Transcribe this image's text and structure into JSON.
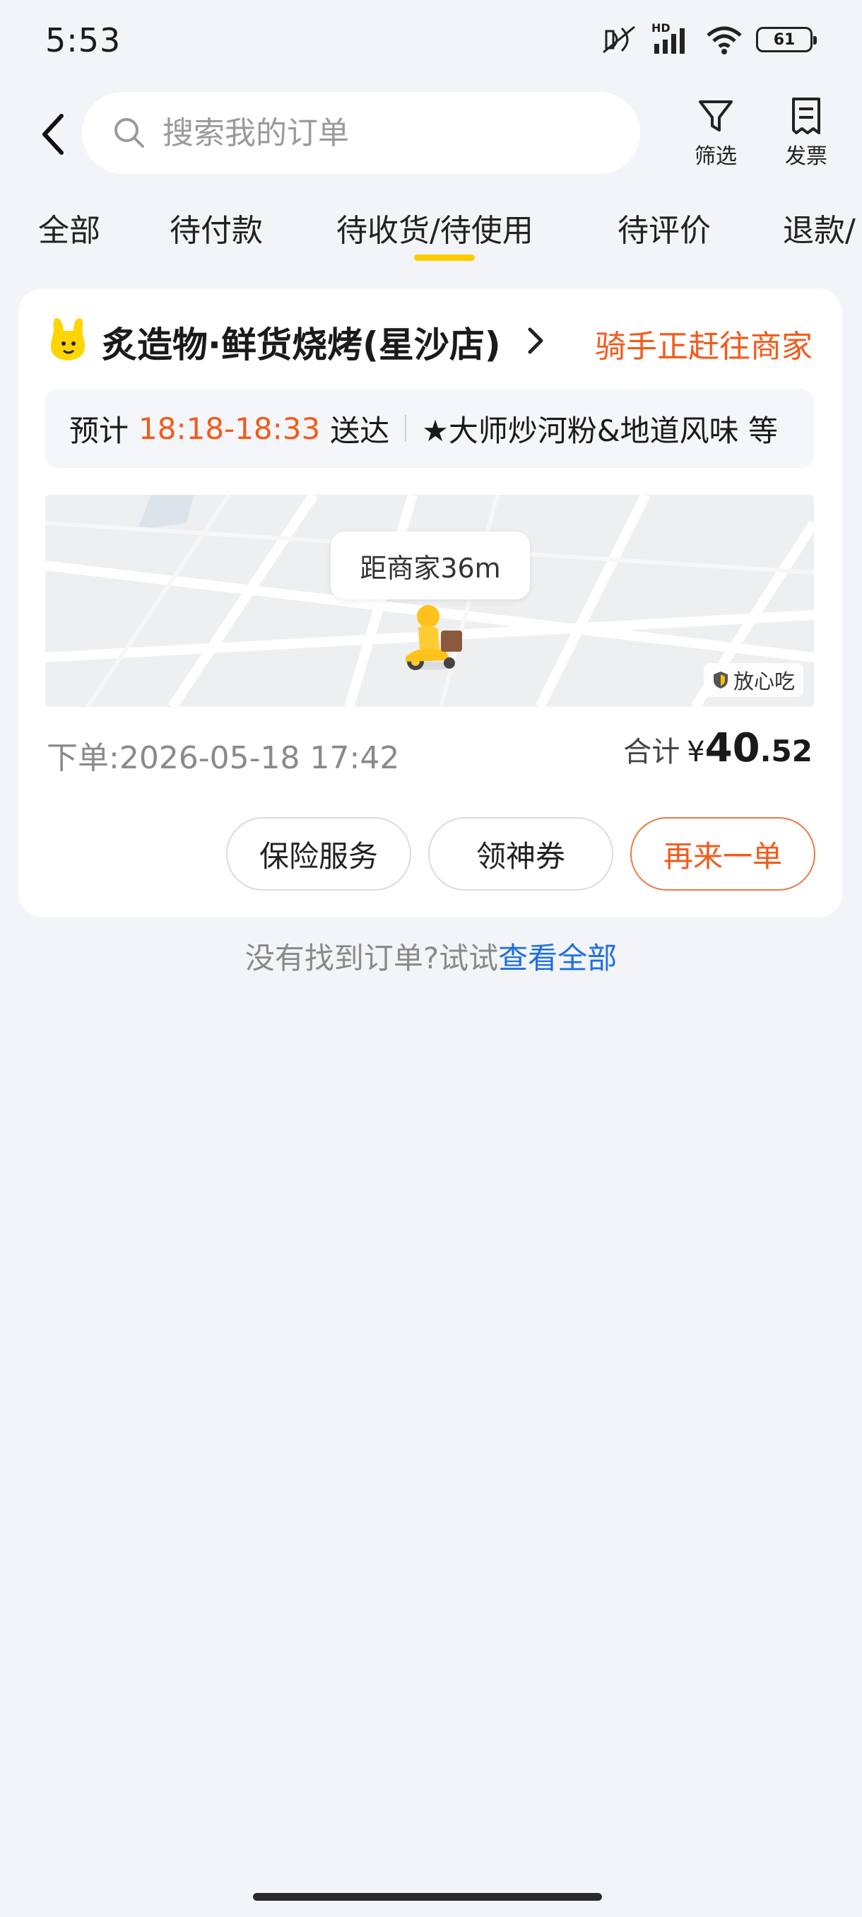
{
  "status_bar": {
    "time": "5:53",
    "network_label": "HD",
    "battery": "61",
    "icons": [
      "mute-icon",
      "signal-icon",
      "wifi-icon",
      "battery-icon"
    ]
  },
  "header": {
    "search_placeholder": "搜索我的订单",
    "filter_label": "筛选",
    "invoice_label": "发票"
  },
  "tabs": [
    {
      "label": "全部"
    },
    {
      "label": "待付款"
    },
    {
      "label": "待收货/待使用",
      "active": true
    },
    {
      "label": "待评价"
    },
    {
      "label": "退款/"
    }
  ],
  "order": {
    "shop_name": "炙造物·鲜货烧烤(星沙店)",
    "status": "骑手正赶往商家",
    "eta_prefix": "预计",
    "eta_time": "18:18-18:33",
    "eta_suffix": "送达",
    "items_summary": "★大师炒河粉&地道风味 等",
    "map": {
      "distance": "距商家36m",
      "badge": "放心吃"
    },
    "placed_label": "下单:",
    "placed_time": "2026-05-18 17:42",
    "total_label": "合计",
    "currency": "¥",
    "total_int": "40",
    "total_dec": ".52",
    "buttons": {
      "insurance": "保险服务",
      "coupon": "领神券",
      "reorder": "再来一单"
    }
  },
  "footer": {
    "not_found_text": "没有找到订单?试试",
    "view_all_link": "查看全部"
  },
  "colors": {
    "accent_orange": "#f25a1a",
    "tab_underline": "#ffcc00",
    "link_blue": "#1e6fe0",
    "background": "#f3f4f8"
  }
}
